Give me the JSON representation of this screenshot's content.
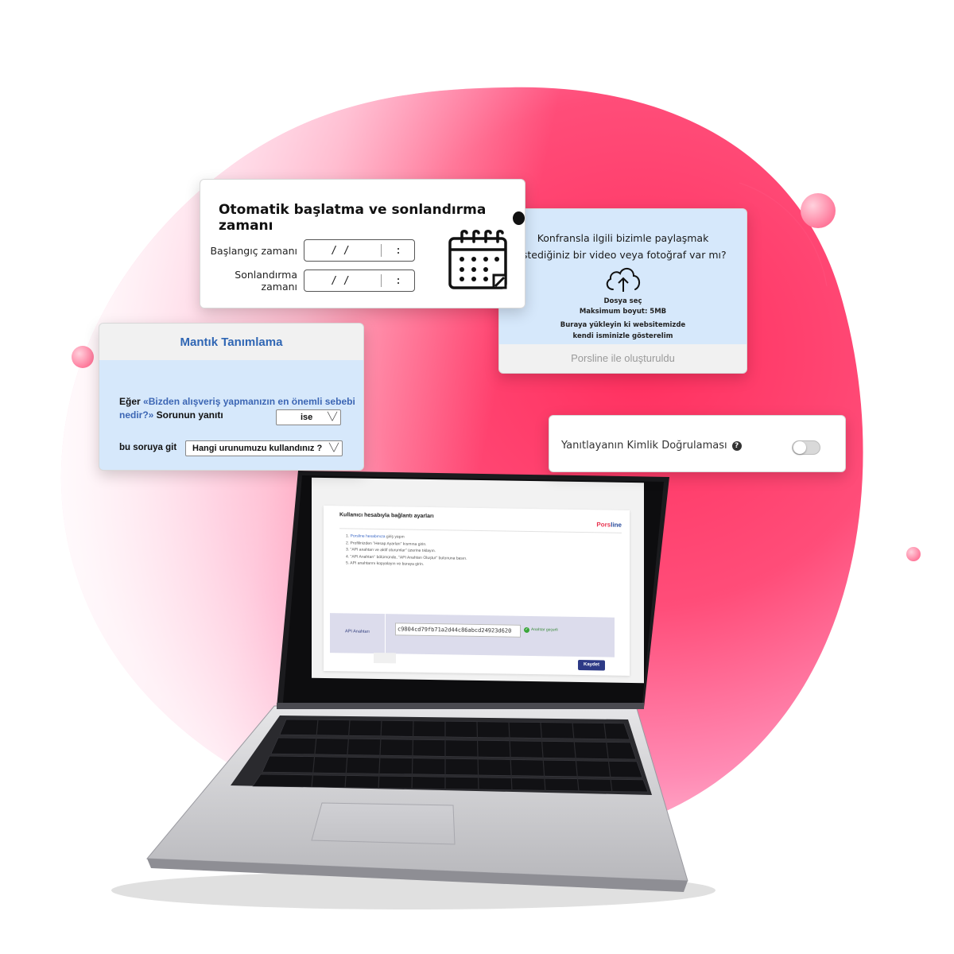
{
  "colors": {
    "blob_primary": "#ff3d6e",
    "blob_secondary": "#ff7ab0",
    "card_blue": "#d6e8fb",
    "brand_red": "#e8334f",
    "brand_blue": "#2b4d9c"
  },
  "schedule_card": {
    "title": "Otomatik başlatma ve sonlandırma zamanı",
    "start_label": "Başlangıç zamanı",
    "end_label": "Sonlandırma zamanı",
    "date_placeholder": "/   /",
    "time_placeholder": ":",
    "icon": "calendar-icon"
  },
  "upload_card": {
    "question_line1": "Konfransla ilgili bizimle paylaşmak",
    "question_line2": "istediğiniz bir video veya fotoğraf var mı?",
    "choose_file": "Dosya seç",
    "max_size": "Maksimum boyut: 5MB",
    "note_line1": "Buraya yükleyin ki websitemizde",
    "note_line2": "kendi isminizle gösterelim",
    "footer": "Porsline ile oluşturuldu",
    "icon": "cloud-upload-icon"
  },
  "logic_card": {
    "title": "Mantık Tanımlama",
    "prefix": "Eğer ",
    "question": "«Bizden alışveriş yapmanızın en önemli sebebi nedir?»",
    "suffix": " Sorunun yanıtı",
    "condition": "ise",
    "goto_label": "bu soruya git",
    "target_question": "Hangi urunumuzu kullandınız ?"
  },
  "identity_card": {
    "label": "Yanıtlayanın Kimlik Doğrulaması",
    "help": "?",
    "toggle_on": false
  },
  "laptop_screen": {
    "title": "Kullanıcı hesabıyla bağlantı ayarları",
    "logo_part1": "Pors",
    "logo_part2": "line",
    "steps": [
      {
        "link": "Porsline hesabınıza",
        "text": " giriş yapın"
      },
      {
        "link": "",
        "text": "2. Profilinizden \"Hesap Ayarları\" kısmına girin."
      },
      {
        "link": "",
        "text": "3. \"API anahtarı ve aktif oturumlar\" üzerine tıklayın."
      },
      {
        "link": "",
        "text": "4. \"API Anahtarı\" bölümünde, \"API Anahtarı Oluştur\" butonuna basın."
      },
      {
        "link": "",
        "text": "5. API anahtarını kopyalayın ve buraya girin."
      }
    ],
    "step1_prefix": "1. ",
    "api_key_label": "API Anahtarı",
    "api_key_value": "c9804cd79fb71a2d44c86abcd24923d620",
    "api_key_status": "Anahtar geçerli",
    "save_label": "Kaydet"
  }
}
